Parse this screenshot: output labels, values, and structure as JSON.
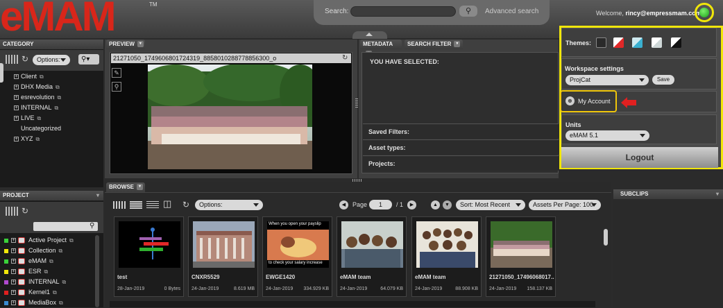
{
  "brand": {
    "logo": "eMAM",
    "tm": "TM"
  },
  "search": {
    "label": "Search:",
    "button": "🔍",
    "advanced": "Advanced search"
  },
  "user": {
    "welcome": "Welcome,",
    "email": "rincy@empressmam.com"
  },
  "category": {
    "header": "CATEGORY",
    "options_label": "Options:",
    "items": [
      {
        "label": "Client"
      },
      {
        "label": "DHX Media"
      },
      {
        "label": "esrevolution"
      },
      {
        "label": "INTERNAL"
      },
      {
        "label": "LIVE"
      },
      {
        "label": "Uncategorized"
      },
      {
        "label": "XYZ"
      }
    ]
  },
  "preview": {
    "header": "PREVIEW",
    "title": "21271050_1749606801724319_8858010288778856300_o"
  },
  "metadata": {
    "tab_metadata": "METADATA",
    "tab_search_filter": "SEARCH FILTER",
    "selected_label": "YOU HAVE SELECTED:",
    "rows": [
      "Saved Filters:",
      "Asset types:",
      "Projects:"
    ]
  },
  "project": {
    "header": "PROJECT",
    "items": [
      {
        "label": "Active Project",
        "color": "#3ad13a"
      },
      {
        "label": "Collection",
        "color": "#f0e60a"
      },
      {
        "label": "eMAM",
        "color": "#3ad13a"
      },
      {
        "label": "ESR",
        "color": "#f0e60a"
      },
      {
        "label": "INTERNAL",
        "color": "#b04ad0"
      },
      {
        "label": "Kernel1",
        "color": "#e02020"
      },
      {
        "label": "MediaBox",
        "color": "#3a8ad0"
      }
    ]
  },
  "browse": {
    "header": "BROWSE",
    "options_label": "Options:",
    "page_label": "Page",
    "page_value": "1",
    "page_total": "/ 1",
    "sort_label": "Sort: Most Recent",
    "per_page_label": "Assets Per Page: 100",
    "assets": [
      {
        "name": "test",
        "date": "28-Jan-2019",
        "size": "0 Bytes",
        "thumb": "graphic"
      },
      {
        "name": "CNXR5529",
        "date": "24-Jan-2019",
        "size": "8.619 MB",
        "thumb": "building"
      },
      {
        "name": "EWGE1420",
        "date": "24-Jan-2019",
        "size": "334.929 KB",
        "thumb": "meme",
        "caption_top": "When you open your payslip",
        "caption_bottom": "to check your salary increase"
      },
      {
        "name": "eMAM team",
        "date": "24-Jan-2019",
        "size": "64.079 KB",
        "thumb": "selfie1"
      },
      {
        "name": "eMAM team",
        "date": "24-Jan-2019",
        "size": "88.908 KB",
        "thumb": "selfie2"
      },
      {
        "name": "21271050_17496068017...",
        "date": "24-Jan-2019",
        "size": "158.137 KB",
        "thumb": "group"
      }
    ]
  },
  "subclips": {
    "header": "SUBCLIPS"
  },
  "popup": {
    "themes_label": "Themes:",
    "theme_colors": [
      "#2a2a2a",
      "#e02828",
      "#3ab0d0",
      "#e8e8e8",
      "#111111"
    ],
    "workspace_label": "Workspace settings",
    "workspace_value": "ProjCat",
    "save_label": "Save",
    "my_account_label": "My Account",
    "units_label": "Units",
    "units_value": "eMAM 5.1",
    "logout_label": "Logout"
  },
  "colors": {
    "accent_yellow": "#f0e60a",
    "logo_red": "#d8261a",
    "status_green": "#2dbd2d"
  }
}
